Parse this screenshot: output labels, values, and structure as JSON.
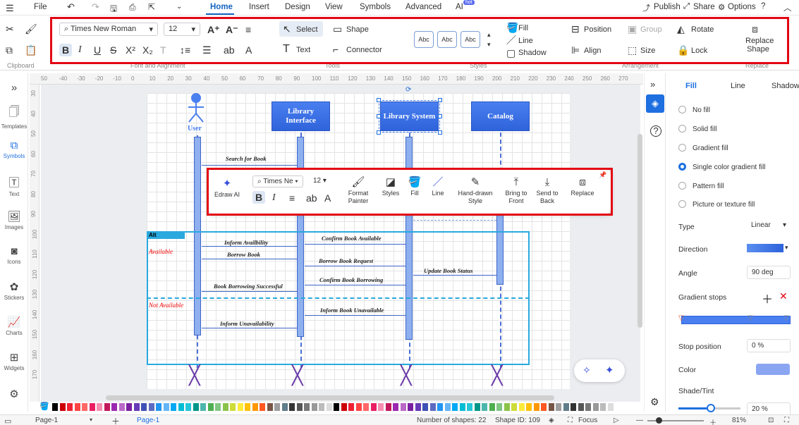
{
  "menu": {
    "file": "File",
    "tabs": [
      "Home",
      "Insert",
      "Design",
      "View",
      "Symbols",
      "Advanced",
      "AI"
    ],
    "ai_badge": "hot",
    "publish": "Publish",
    "share": "Share",
    "options": "Options"
  },
  "ribbon": {
    "font": "Times New Roman",
    "size": "12",
    "select": "Select",
    "shape": "Shape",
    "text": "Text",
    "connector": "Connector",
    "style_sample": "Abc",
    "fill": "Fill",
    "line": "Line",
    "shadow": "Shadow",
    "position": "Position",
    "group": "Group",
    "rotate": "Rotate",
    "align": "Align",
    "size_label": "Size",
    "lock": "Lock",
    "replace_shape": "Replace Shape",
    "groups": {
      "clipboard": "Clipboard",
      "font": "Font and Alignment",
      "tools": "Tools",
      "styles": "Styles",
      "arrangement": "Arrangement",
      "replace": "Replace"
    }
  },
  "ruler": {
    "h": [
      "50",
      "-40",
      "-30",
      "-20",
      "-10",
      "0",
      "10",
      "20",
      "30",
      "40",
      "50",
      "60",
      "70",
      "80",
      "90",
      "100",
      "110",
      "120",
      "130",
      "140",
      "150",
      "160",
      "170",
      "180",
      "190",
      "200",
      "210",
      "220",
      "230",
      "240",
      "250",
      "260",
      "270"
    ],
    "v": [
      "30",
      "40",
      "50",
      "60",
      "70",
      "80",
      "90",
      "100",
      "110",
      "120",
      "130",
      "140",
      "150",
      "160",
      "170"
    ]
  },
  "leftbar": [
    {
      "label": "Templates",
      "icon": "templates-icon"
    },
    {
      "label": "Symbols",
      "icon": "symbols-icon"
    },
    {
      "label": "Text",
      "icon": "text-icon"
    },
    {
      "label": "Images",
      "icon": "images-icon"
    },
    {
      "label": "Icons",
      "icon": "icons-icon"
    },
    {
      "label": "Stickers",
      "icon": "stickers-icon"
    },
    {
      "label": "Charts",
      "icon": "charts-icon"
    },
    {
      "label": "Widgets",
      "icon": "widgets-icon"
    }
  ],
  "diagram": {
    "actor": "User",
    "lifelines": [
      "Library Interface",
      "Library System",
      "Catalog"
    ],
    "messages": [
      "Search for Book",
      "Confirm Book Available",
      "Inform Availbility",
      "Borrow Book",
      "Borrow Book Request",
      "Update Book Status",
      "Confirm Book Borrowing",
      "Book Borrowing Successful",
      "Inform Book Unavailable",
      "Inform Unavailability"
    ],
    "alt": "Alt",
    "cond1": "Available",
    "cond2": "Not Available"
  },
  "floatbar": {
    "edraw_ai": "Edraw AI",
    "font": "Times Ne",
    "size": "12",
    "format_painter": "Format Painter",
    "styles": "Styles",
    "fill": "Fill",
    "line": "Line",
    "hand_drawn": "Hand-drawn Style",
    "bring_front": "Bring to Front",
    "send_back": "Send to Back",
    "replace": "Replace"
  },
  "panel": {
    "tabs": [
      "Fill",
      "Line",
      "Shadow"
    ],
    "options": [
      "No fill",
      "Solid fill",
      "Gradient fill",
      "Single color gradient fill",
      "Pattern fill",
      "Picture or texture fill"
    ],
    "selected": 3,
    "type_label": "Type",
    "type_value": "Linear",
    "direction_label": "Direction",
    "angle_label": "Angle",
    "angle_value": "90 deg",
    "stops_label": "Gradient stops",
    "stop_pos_label": "Stop position",
    "stop_pos_value": "0 %",
    "color_label": "Color",
    "shade_label": "Shade/Tint",
    "shade_value": "20 %",
    "color": "#8aa6f2"
  },
  "status": {
    "page_sel": "Page-1",
    "page_tab": "Page-1",
    "shapes": "Number of shapes: 22",
    "shape_id": "Shape ID: 109",
    "focus": "Focus",
    "zoom": "81%"
  }
}
